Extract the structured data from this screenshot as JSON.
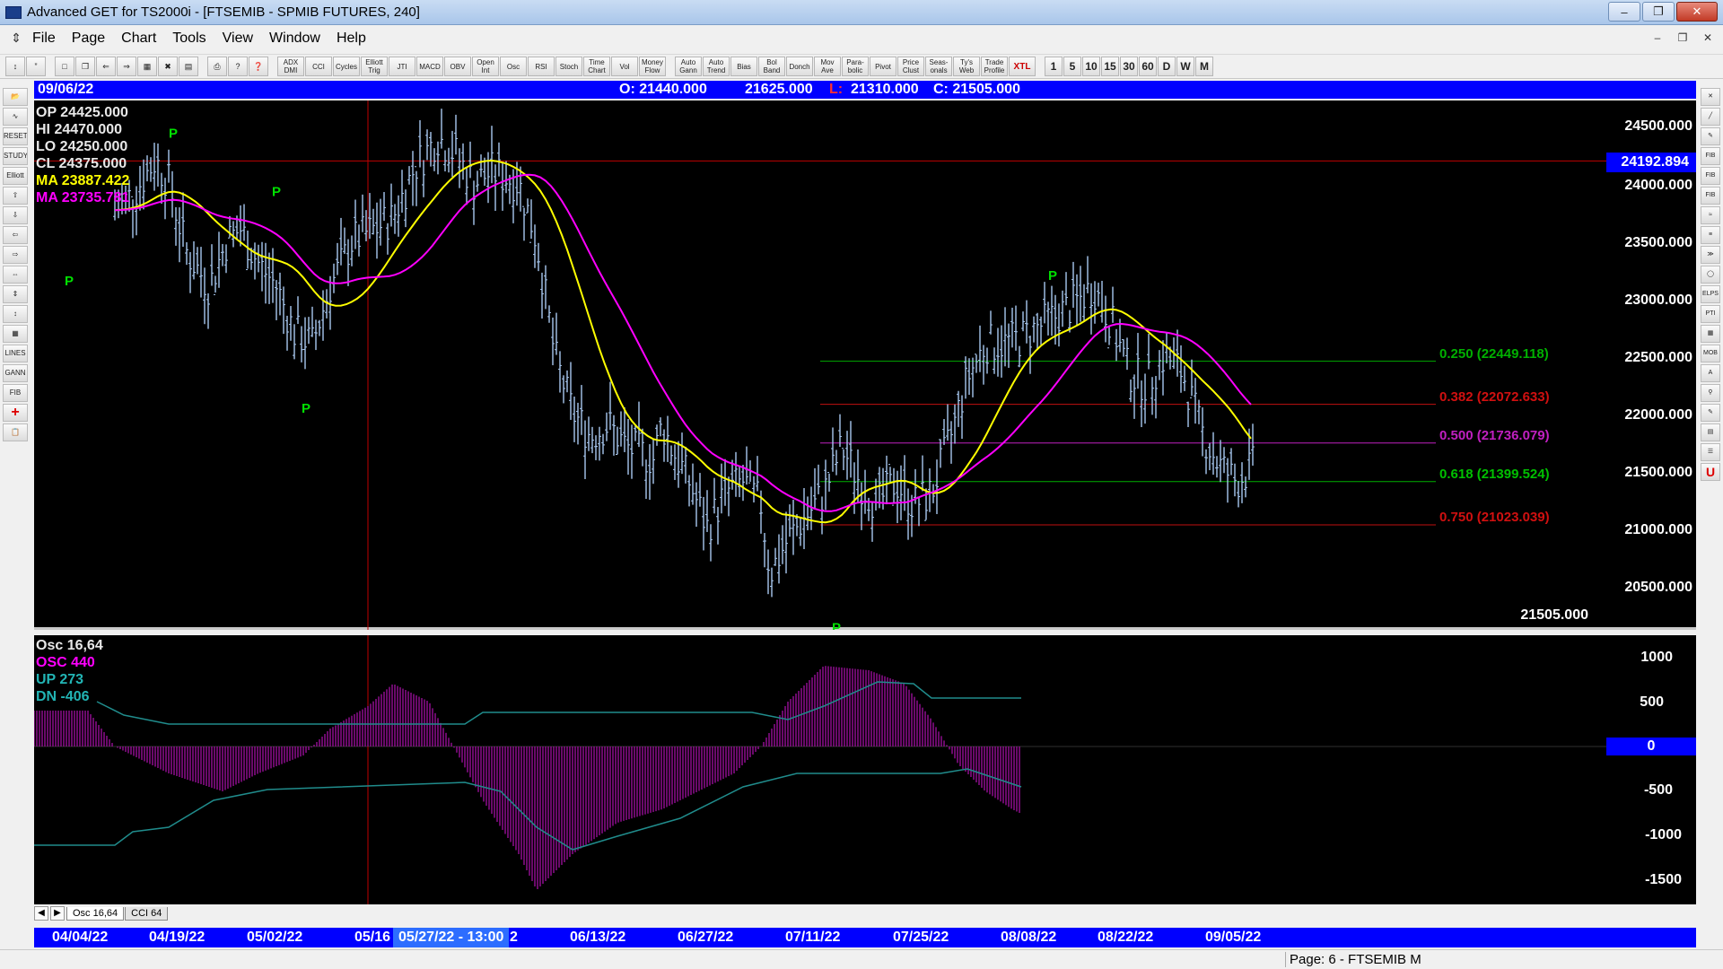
{
  "window": {
    "title": "Advanced GET for TS2000i - [FTSEMIB - SPMIB FUTURES, 240]"
  },
  "menu": [
    "File",
    "Page",
    "Chart",
    "Tools",
    "View",
    "Window",
    "Help"
  ],
  "toolbar": {
    "indicators": [
      "ADX DMI",
      "CCI",
      "Cycles",
      "Elliott Trig",
      "JTI",
      "MACD",
      "OBV",
      "Open Int",
      "Osc",
      "RSI",
      "Stoch",
      "Time Chart",
      "Vol",
      "Money Flow",
      "Auto Gann",
      "Auto Trend",
      "Bias",
      "Bol Band",
      "Donch",
      "Mov Ave",
      "Para-bolic",
      "Pivot",
      "Price Clust",
      "Seas-onals",
      "Ty's Web",
      "Trade Profile",
      "XTL"
    ],
    "periods": [
      "1",
      "5",
      "10",
      "15",
      "30",
      "60",
      "D",
      "W",
      "M"
    ]
  },
  "header": {
    "date": "09/06/22",
    "open": "O: 21440.000",
    "high": "21625.000",
    "low_label": "L:",
    "low": "21310.000",
    "close": "C: 21505.000"
  },
  "price_pane": {
    "stats": {
      "op": "OP  24425.000",
      "hi": "HI   24470.000",
      "lo": "LO  24250.000",
      "cl": "CL  24375.000",
      "ma1": "MA  23887.422",
      "ma2": "MA  23735.781"
    },
    "ticks": [
      "24500.000",
      "24000.000",
      "23500.000",
      "23000.000",
      "22500.000",
      "22000.000",
      "21500.000",
      "21000.000",
      "20500.000"
    ],
    "crosshair_value": "24192.894",
    "close_readout": "21505.000",
    "pivot_label": "P",
    "fib_levels": [
      {
        "label": "0.250  (22449.118)",
        "color": "#00b000"
      },
      {
        "label": "0.382  (22072.633)",
        "color": "#d01010"
      },
      {
        "label": "0.500  (21736.079)",
        "color": "#c020c0"
      },
      {
        "label": "0.618  (21399.524)",
        "color": "#00c000"
      },
      {
        "label": "0.750  (21023.039)",
        "color": "#d01010"
      }
    ]
  },
  "osc_pane": {
    "stats": {
      "title": "Osc 16,64",
      "osc": "OSC  440",
      "up": "UP   273",
      "dn": "DN   -406"
    },
    "ticks": [
      "1000",
      "500",
      "-500",
      "-1000",
      "-1500"
    ],
    "zero": "0"
  },
  "tabs": [
    "Osc 16,64",
    "CCI 64"
  ],
  "date_axis": {
    "labels": [
      "04/04/22",
      "04/19/22",
      "05/02/22",
      "05/16",
      "2",
      "06/13/22",
      "06/27/22",
      "07/11/22",
      "07/25/22",
      "08/08/22",
      "08/22/22",
      "09/05/22"
    ],
    "cursor": "05/27/22 - 13:00"
  },
  "status": {
    "page": "Page: 6 - FTSEMIB M"
  },
  "colors": {
    "background": "#000000",
    "bars": "#a8c8f0",
    "ma_fast": "#ffff00",
    "ma_slow": "#ff00ff",
    "osc_hist": "#b010b0",
    "osc_bands": "#208c8c",
    "accent_blue": "#0000ff"
  }
}
